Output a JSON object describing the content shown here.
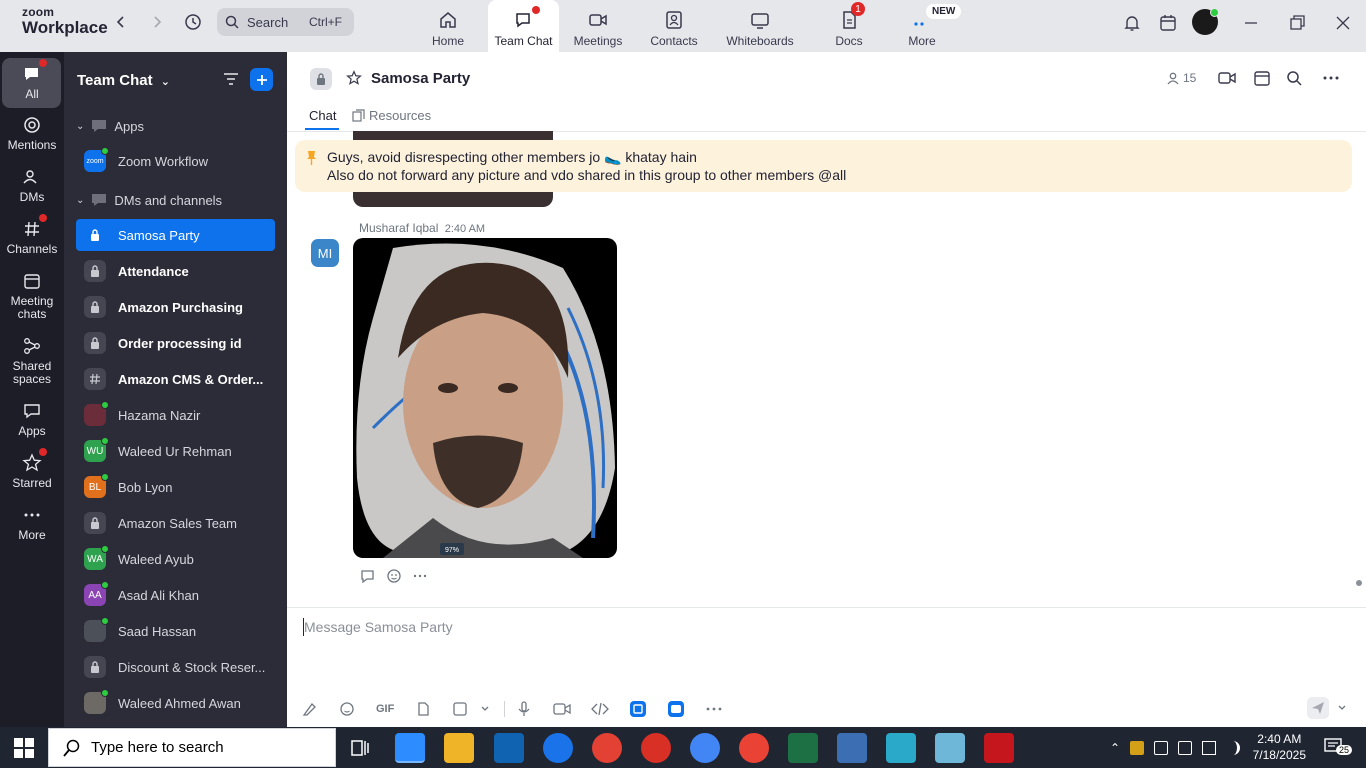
{
  "app": {
    "logo_line1": "zoom",
    "logo_line2": "Workplace",
    "search_placeholder": "Search",
    "search_shortcut": "Ctrl+F"
  },
  "tabs": [
    {
      "label": "Home",
      "icon": "home-icon"
    },
    {
      "label": "Team Chat",
      "icon": "chat-icon",
      "active": true
    },
    {
      "label": "Meetings",
      "icon": "video-icon"
    },
    {
      "label": "Contacts",
      "icon": "contacts-icon"
    },
    {
      "label": "Whiteboards",
      "icon": "whiteboard-icon"
    },
    {
      "label": "Docs",
      "icon": "docs-icon",
      "badge": "1"
    },
    {
      "label": "More",
      "icon": "more-icon",
      "badge": "NEW"
    }
  ],
  "rail": [
    {
      "label": "All",
      "icon": "chat-icon",
      "active": true
    },
    {
      "label": "Mentions",
      "icon": "at-icon"
    },
    {
      "label": "DMs",
      "icon": "people-icon"
    },
    {
      "label": "Channels",
      "icon": "hash-icon"
    },
    {
      "label": "Meeting\nchats",
      "icon": "calendar-icon"
    },
    {
      "label": "Shared\nspaces",
      "icon": "share-icon"
    },
    {
      "label": "Apps",
      "icon": "apps-icon"
    },
    {
      "label": "Starred",
      "icon": "star-icon"
    },
    {
      "label": "More",
      "icon": "more-icon"
    }
  ],
  "sidebar": {
    "title": "Team Chat",
    "section_apps": "Apps",
    "zoom_workflow": "Zoom Workflow",
    "zoom_logo": "zoom",
    "section_dms": "DMs and channels",
    "items": [
      {
        "label": "Samosa Party",
        "type": "lock",
        "selected": true
      },
      {
        "label": "Attendance",
        "type": "lock",
        "bold": true
      },
      {
        "label": "Amazon Purchasing",
        "type": "lock",
        "bold": true
      },
      {
        "label": "Order processing id",
        "type": "lock",
        "bold": true
      },
      {
        "label": "Amazon CMS & Order...",
        "type": "hash",
        "bold": true
      },
      {
        "label": "Hazama Nazir",
        "type": "photo",
        "color": "#6b2d3a"
      },
      {
        "label": "Waleed Ur Rehman",
        "type": "initials",
        "initials": "WU",
        "color": "#2fa24f"
      },
      {
        "label": "Bob Lyon",
        "type": "initials",
        "initials": "BL",
        "color": "#e0701b"
      },
      {
        "label": "Amazon Sales Team",
        "type": "lock"
      },
      {
        "label": "Waleed Ayub",
        "type": "initials",
        "initials": "WA",
        "color": "#2fa24f"
      },
      {
        "label": "Asad Ali Khan",
        "type": "initials",
        "initials": "AA",
        "color": "#8b44b3"
      },
      {
        "label": "Saad Hassan",
        "type": "photo",
        "color": "#4c5058"
      },
      {
        "label": "Discount & Stock Reser...",
        "type": "lock"
      },
      {
        "label": "Waleed Ahmed Awan",
        "type": "photo",
        "color": "#6d6a66"
      }
    ]
  },
  "chat": {
    "title": "Samosa Party",
    "member_count": "15",
    "tab_chat": "Chat",
    "tab_resources": "Resources",
    "pinned_line1": "Guys, avoid disrespecting other members jo 🥿 khatay hain",
    "pinned_line2": "Also do not forward any picture and vdo shared in this group to other members @all",
    "sender": "Musharaf Iqbal",
    "time": "2:40 AM",
    "sender_initials": "MI",
    "image_tag": "97%",
    "compose_placeholder": "Message Samosa Party",
    "gif_label": "GIF"
  },
  "taskbar": {
    "search_placeholder": "Type here to search",
    "time": "2:40 AM",
    "date": "7/18/2025",
    "notifications": "25"
  }
}
